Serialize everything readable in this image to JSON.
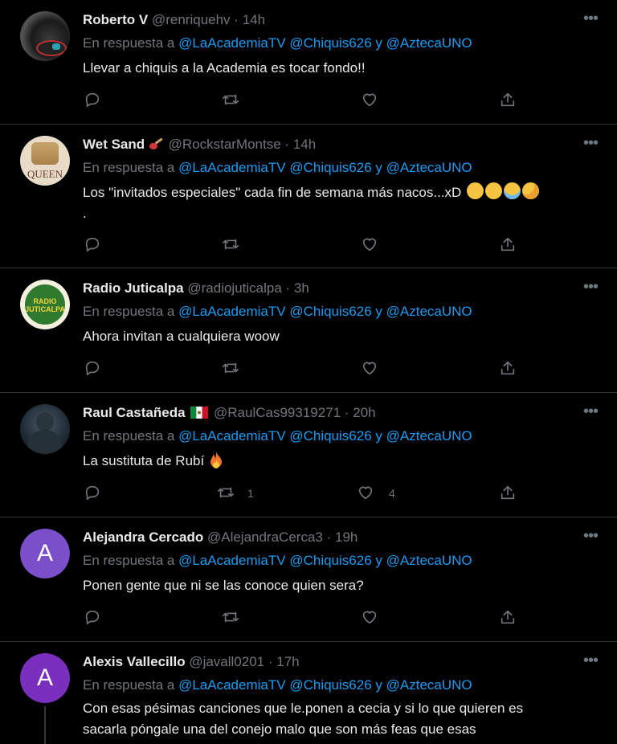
{
  "reply_prefix": "En respuesta a",
  "mentions": [
    "@LaAcademiaTV",
    "@Chiquis626",
    "@AztecaUNO"
  ],
  "joiner": "y",
  "tweets": [
    {
      "name": "Roberto V",
      "handle": "@renriquehv",
      "time": "14h",
      "text": "Llevar a  chiquis a la Academia es tocar fondo!!",
      "retweets": "",
      "likes": "",
      "avatar": "photo-dark"
    },
    {
      "name": "Wet Sand",
      "flag_icon": "guitar-icon",
      "handle": "@RockstarMontse",
      "time": "14h",
      "text": "Los \"invitados especiales\" cada fin de semana más nacos...xD",
      "text_line2": ".",
      "emoji": [
        "grinning-squinting-face",
        "grinning-squinting-face",
        "face-with-tears-of-joy",
        "face-with-hand-over-mouth"
      ],
      "retweets": "",
      "likes": "",
      "avatar": "queen-logo",
      "avatar_text": "QUEEN"
    },
    {
      "name": "Radio Juticalpa",
      "handle": "@radiojuticalpa",
      "time": "3h",
      "text": "Ahora invitan a cualquiera woow",
      "retweets": "",
      "likes": "",
      "avatar": "radio-logo",
      "avatar_text": "RADIO JUTICALPA"
    },
    {
      "name": "Raul Castañeda",
      "flag_icon": "mexico-flag-icon",
      "handle": "@RaulCas99319271",
      "time": "20h",
      "text": "La sustituta de Rubí",
      "emoji": [
        "fire"
      ],
      "retweets": "1",
      "likes": "4",
      "avatar": "photo-dark"
    },
    {
      "name": "Alejandra Cercado",
      "handle": "@AlejandraCerca3",
      "time": "19h",
      "text": "Ponen gente que ni se las conoce quien sera?",
      "retweets": "",
      "likes": "",
      "avatar": "letter",
      "avatar_letter": "A",
      "avatar_color": "#7b4fc9"
    },
    {
      "name": "Alexis Vallecillo",
      "handle": "@javall0201",
      "time": "17h",
      "text": "Con esas pésimas canciones  que le.ponen a cecia y si lo que quieren es",
      "text_line2": "sacarla póngale una del conejo malo que son más feas que esas",
      "retweets": "",
      "likes": "",
      "avatar": "letter",
      "avatar_letter": "A",
      "avatar_color": "#7b2fbf"
    }
  ],
  "colors": {
    "background": "#000000",
    "mention": "#1d9bf0",
    "muted": "#71767b",
    "border": "#2f3336"
  }
}
